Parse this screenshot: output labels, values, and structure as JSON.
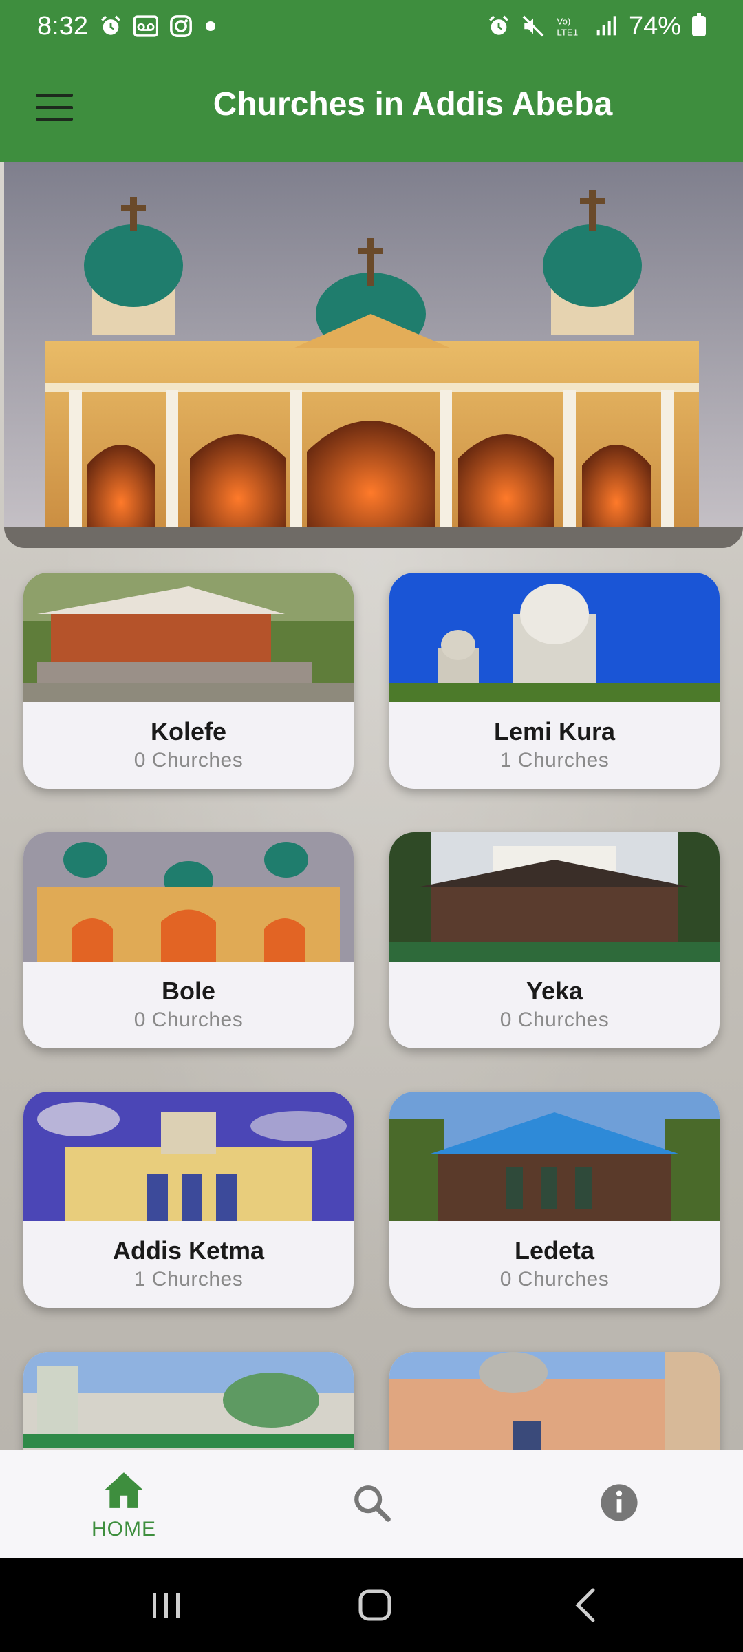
{
  "status_bar": {
    "time": "8:32",
    "battery": "74%",
    "left_icons": [
      "alarm-icon",
      "voicemail-icon",
      "instagram-icon",
      "dot-icon"
    ],
    "right_icons": [
      "alarm-icon",
      "mute-icon",
      "volte-icon",
      "signal-icon",
      "battery-icon"
    ]
  },
  "app_bar": {
    "title": "Churches in Addis Abeba",
    "menu_icon": "hamburger-menu-icon",
    "background": "#3e8e3e"
  },
  "cards": [
    {
      "name": "Kolefe",
      "count": "0 Churches"
    },
    {
      "name": "Lemi Kura",
      "count": "1 Churches"
    },
    {
      "name": "Bole",
      "count": "0 Churches"
    },
    {
      "name": "Yeka",
      "count": "0 Churches"
    },
    {
      "name": "Addis Ketma",
      "count": "1 Churches"
    },
    {
      "name": "Ledeta",
      "count": "0 Churches"
    }
  ],
  "bottom_nav": {
    "items": [
      {
        "label": "HOME",
        "icon": "home-icon",
        "active": true
      },
      {
        "label": "",
        "icon": "search-icon",
        "active": false
      },
      {
        "label": "",
        "icon": "info-icon",
        "active": false
      }
    ],
    "active_color": "#3e8e3e"
  },
  "system_nav": {
    "icons": [
      "recent-apps-icon",
      "home-circle-icon",
      "back-icon"
    ]
  }
}
